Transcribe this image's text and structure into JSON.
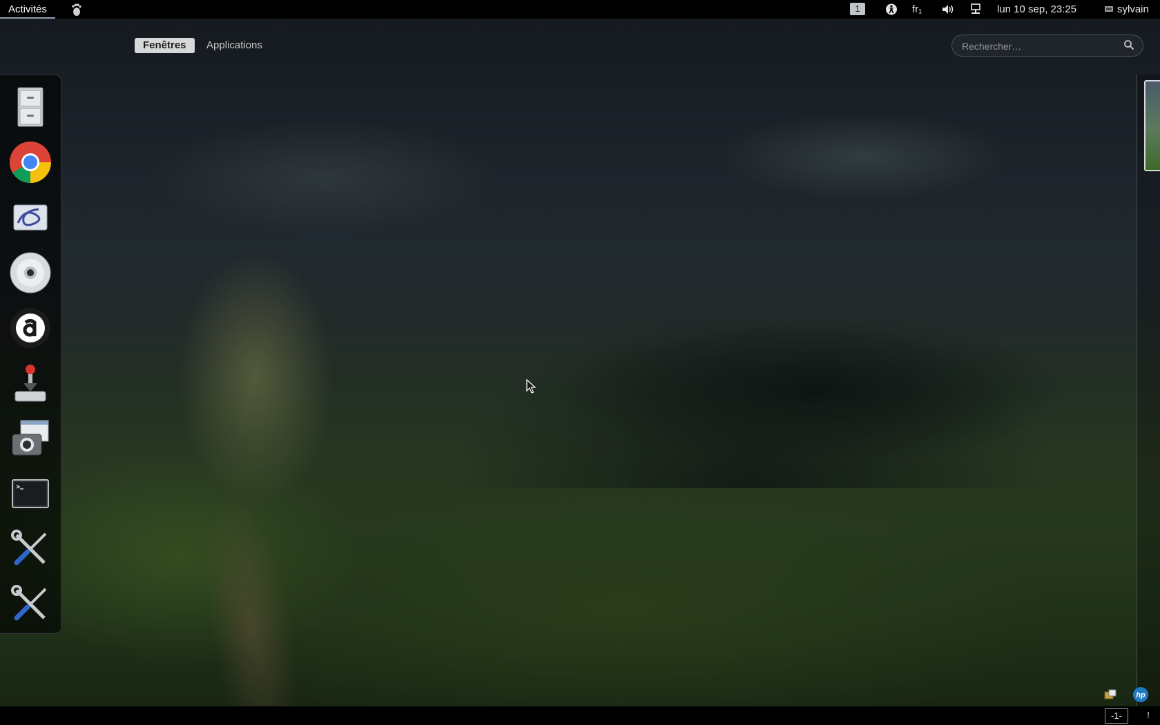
{
  "top_bar": {
    "activities_label": "Activités",
    "workspace_number": "1",
    "keyboard_layout": "fr₁",
    "clock": "lun 10 sep, 23:25",
    "user_name": "sylvain"
  },
  "overview": {
    "tabs": [
      {
        "label": "Fenêtres",
        "active": true
      },
      {
        "label": "Applications",
        "active": false
      }
    ]
  },
  "search": {
    "placeholder": "Rechercher…"
  },
  "dash": {
    "items": [
      {
        "icon": "file-cabinet-icon"
      },
      {
        "icon": "chrome-icon"
      },
      {
        "icon": "swirl-app-icon"
      },
      {
        "icon": "disc-icon"
      },
      {
        "icon": "a-letter-app-icon"
      },
      {
        "icon": "joystick-installer-icon"
      },
      {
        "icon": "screenshot-camera-icon"
      },
      {
        "icon": "terminal-icon"
      },
      {
        "icon": "tools-icon"
      },
      {
        "icon": "tools-icon"
      }
    ]
  },
  "bottom_bar": {
    "workspace_switch_label": "-1-",
    "message_tray_indicator": "!"
  },
  "colors": {
    "top_bar_bg": "#000000",
    "active_tab_bg": "#d7d8d9",
    "dash_bg": "rgba(0,0,0,0.62)"
  }
}
